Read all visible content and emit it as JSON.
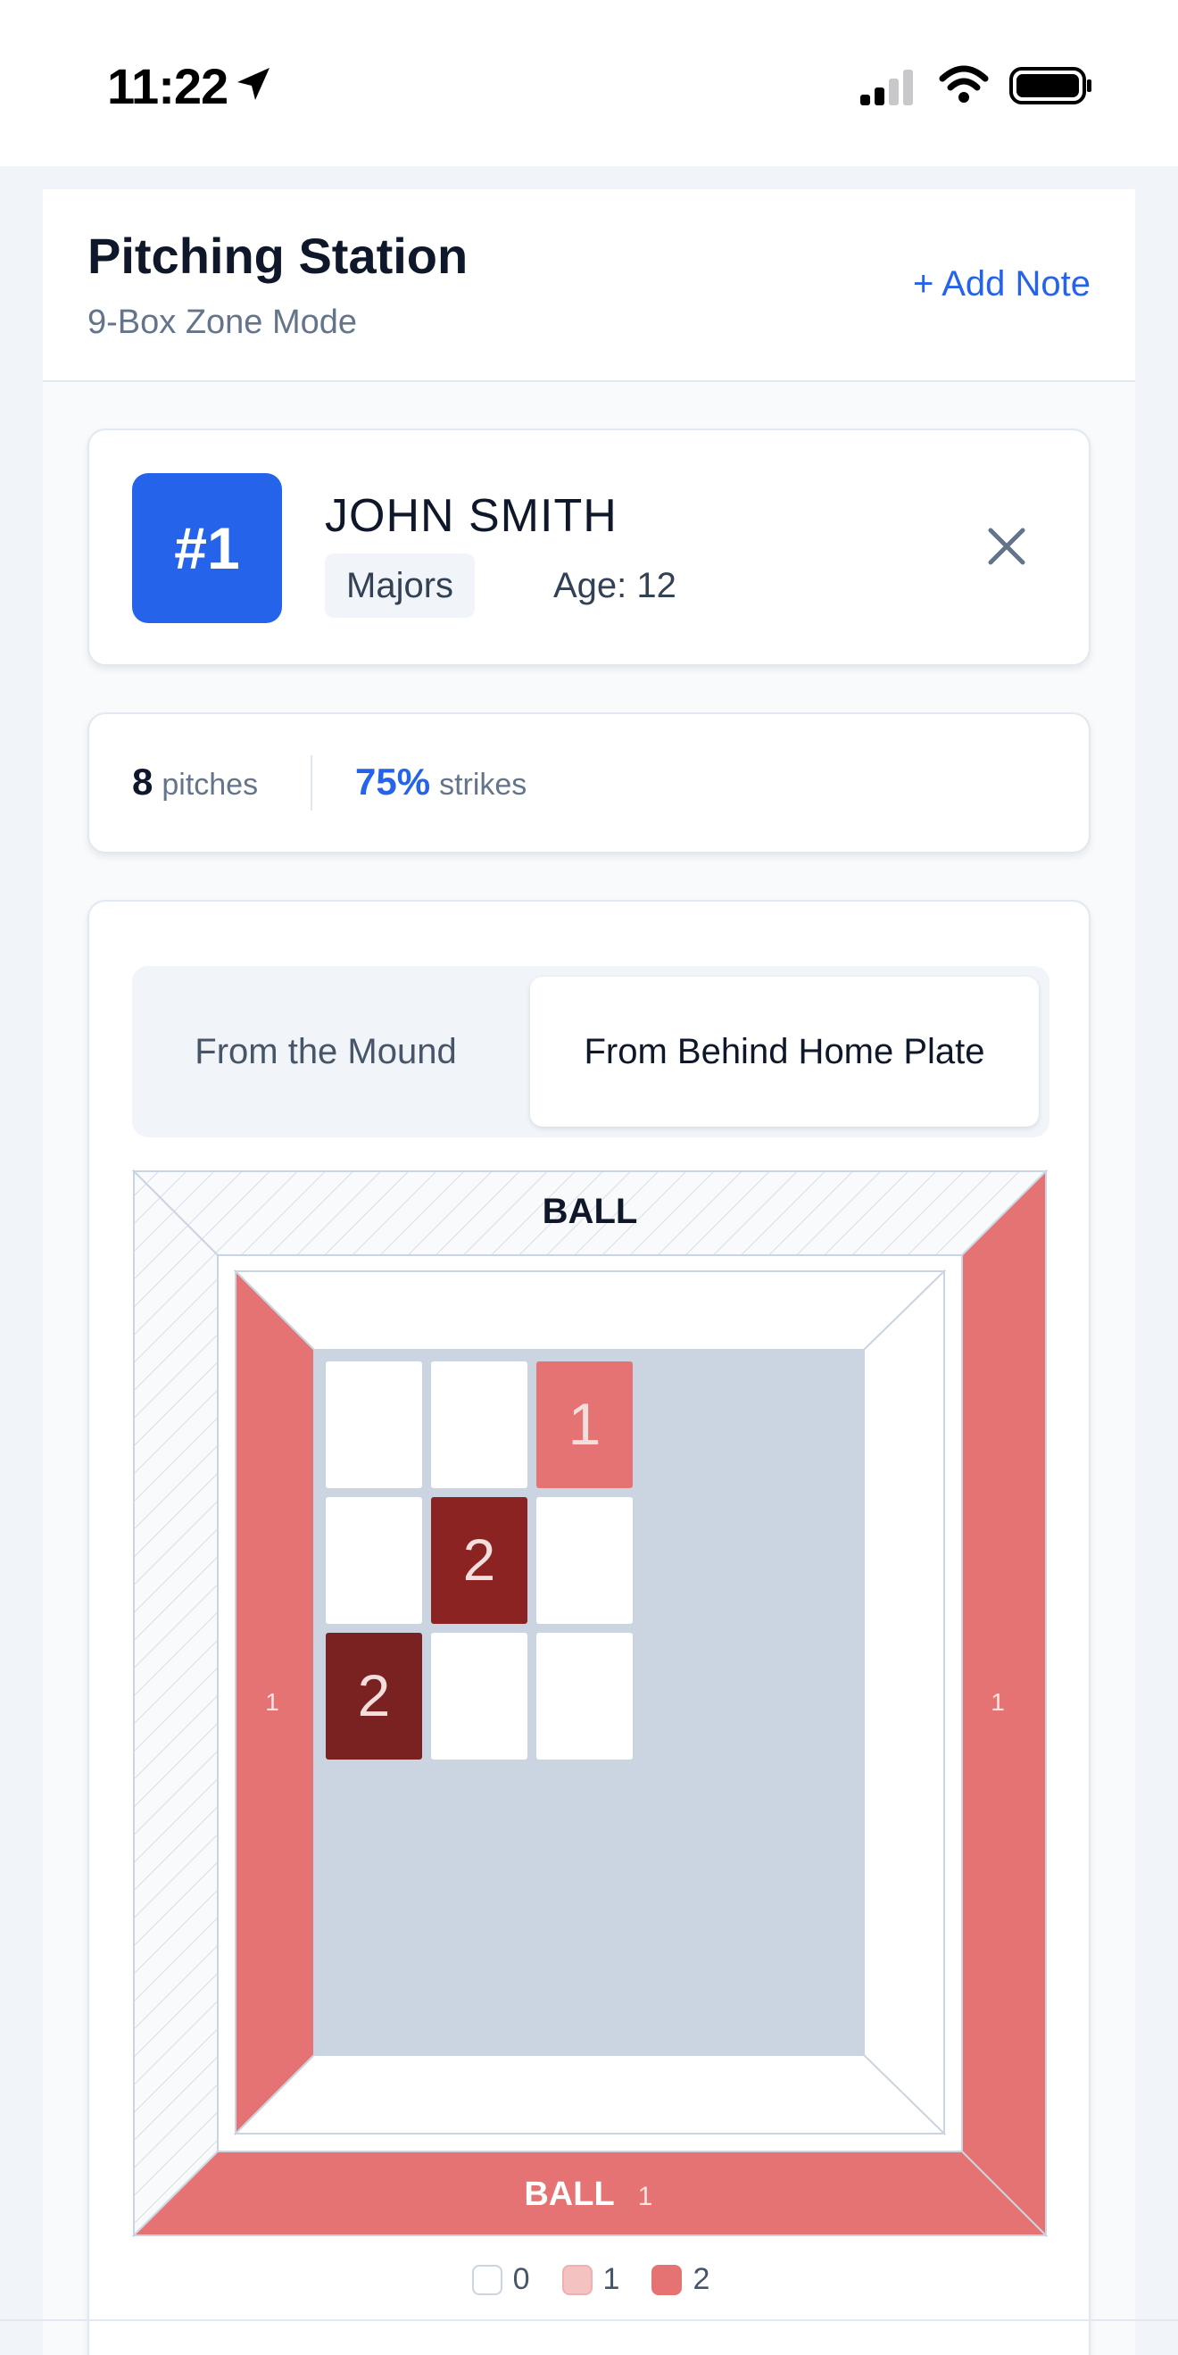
{
  "status_bar": {
    "time": "11:22"
  },
  "header": {
    "title": "Pitching Station",
    "subtitle": "9-Box Zone Mode",
    "add_note_label": "+ Add Note"
  },
  "player": {
    "number": "#1",
    "name": "JOHN SMITH",
    "level": "Majors",
    "age": "Age: 12"
  },
  "stats": {
    "pitches_count": "8",
    "pitches_label": "pitches",
    "strike_pct": "75%",
    "strikes_label": "strikes"
  },
  "view_toggle": {
    "options": [
      "From the Mound",
      "From Behind Home Plate"
    ],
    "selected": "From Behind Home Plate"
  },
  "zone": {
    "ball_top_label": "BALL",
    "ball_bottom_label": "BALL",
    "ball_top_count": 0,
    "ball_bottom_count": 1,
    "ball_left_count": 1,
    "ball_right_count": 1,
    "grid": [
      [
        0,
        0,
        1
      ],
      [
        0,
        2,
        0
      ],
      [
        2,
        0,
        0
      ]
    ]
  },
  "legend": [
    {
      "label": "0"
    },
    {
      "label": "1"
    },
    {
      "label": "2"
    }
  ],
  "colors": {
    "accent": "#2563eb",
    "heat_1": "#e57373",
    "heat_2": "#8b2323",
    "heat_2_dark": "#7a2222"
  }
}
